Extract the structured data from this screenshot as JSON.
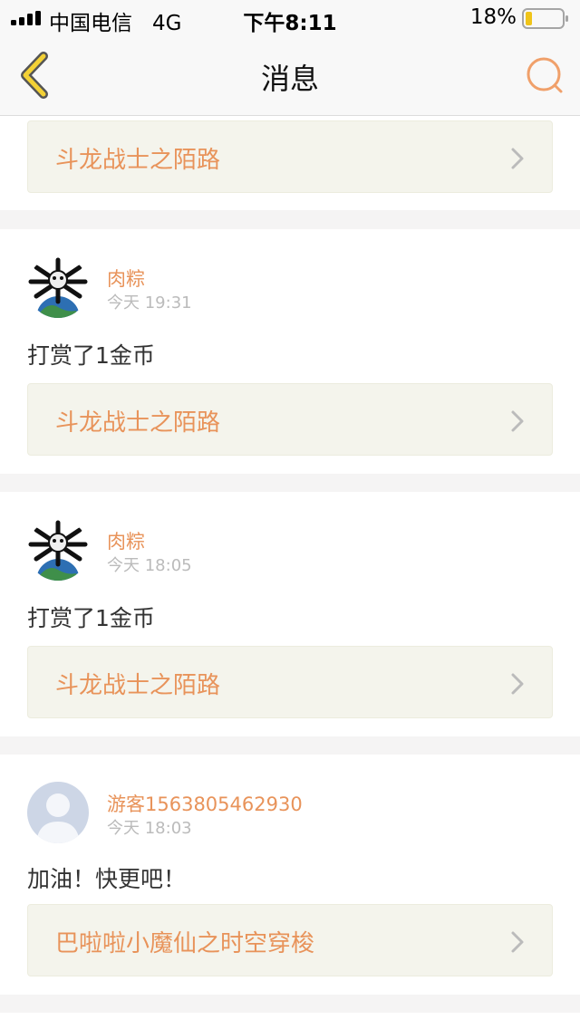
{
  "status_bar": {
    "carrier": "中国电信",
    "network": "4G",
    "time": "下午8:11",
    "battery": "18%",
    "battery_level": 0.18
  },
  "nav": {
    "title": "消息",
    "back_icon": "chevron-left-icon",
    "search_icon": "search-icon"
  },
  "colors": {
    "accent": "#e8935a",
    "back_arrow": "#f3d136",
    "timestamp": "#bbbbbb",
    "link_bg": "#f4f4ec"
  },
  "messages": [
    {
      "link": "斗龙战士之陌路"
    },
    {
      "username": "肉粽",
      "time": "今天 19:31",
      "text": "打赏了1金币",
      "link": "斗龙战士之陌路"
    },
    {
      "username": "肉粽",
      "time": "今天 18:05",
      "text": "打赏了1金币",
      "link": "斗龙战士之陌路"
    },
    {
      "username": "游客1563805462930",
      "time": "今天 18:03",
      "text": "加油！快更吧！",
      "link": "巴啦啦小魔仙之时空穿梭"
    }
  ]
}
